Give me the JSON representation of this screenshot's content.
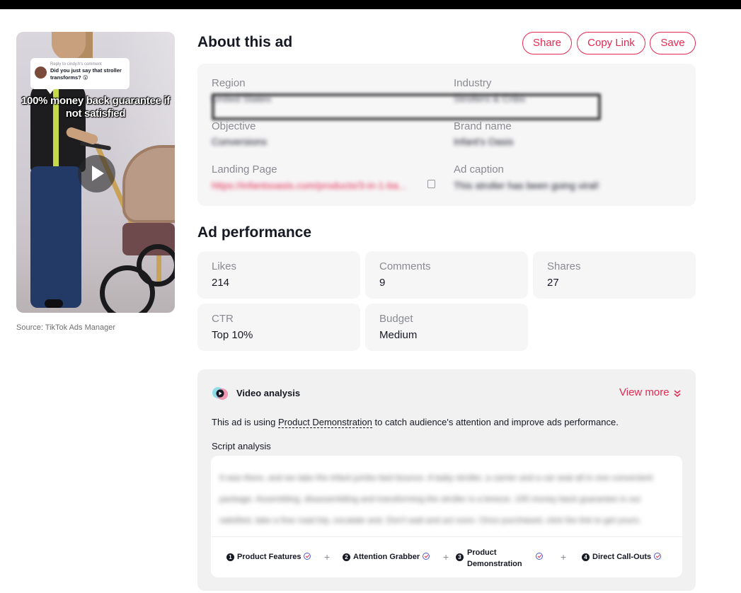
{
  "video": {
    "comment_reply": "Reply to cindy.h's comment",
    "comment_text": "Did you just say that stroller transforms? 😮",
    "overlay_caption": "100% money back guarantee if not satisfied",
    "source": "Source: TikTok Ads Manager"
  },
  "header": {
    "title": "About this ad",
    "share_label": "Share",
    "copy_label": "Copy Link",
    "save_label": "Save"
  },
  "details": {
    "region_label": "Region",
    "region_value": "United States",
    "industry_label": "Industry",
    "industry_value": "Strollers & Cribs",
    "objective_label": "Objective",
    "objective_value": "Conversions",
    "brand_label": "Brand name",
    "brand_value": "Infant's Oasis",
    "landing_label": "Landing Page",
    "landing_value": "https://infantsoasis.com/products/3-in-1-ba...",
    "caption_label": "Ad caption",
    "caption_value": "This stroller has been going viral!"
  },
  "performance": {
    "title": "Ad performance",
    "metrics": [
      {
        "label": "Likes",
        "value": "214"
      },
      {
        "label": "Comments",
        "value": "9"
      },
      {
        "label": "Shares",
        "value": "27"
      },
      {
        "label": "CTR",
        "value": "Top 10%"
      },
      {
        "label": "Budget",
        "value": "Medium"
      }
    ]
  },
  "analysis": {
    "title": "Video analysis",
    "view_more": "View more",
    "sentence_prefix": "This ad is using ",
    "sentence_highlight": "Product Demonstration",
    "sentence_suffix": " to catch audience's attention and improve ads performance.",
    "script_label": "Script analysis",
    "script_text": "It was there, and we take the infant jumbo bed bounce. A baby stroller, a carrier and a car seat all in one convenient package. Assembling, disassembling and transforming the stroller is a breeze. 100 money back guarantee is our satisfied, take a free road trip, escalate and. Don't wait and act soon. Once purchased, click the link to get yours.",
    "tags": [
      {
        "num": "1",
        "label": "Product Features"
      },
      {
        "num": "2",
        "label": "Attention Grabber"
      },
      {
        "num": "3",
        "label": "Product Demonstration"
      },
      {
        "num": "4",
        "label": "Direct Call-Outs"
      }
    ],
    "plus_symbol": "+"
  },
  "icons": {
    "play": "play-icon",
    "copy": "copy-icon",
    "analysis": "video-analysis-icon",
    "chevron": "double-chevron-down-icon",
    "check": "verified-check-icon"
  },
  "colors": {
    "accent": "#e5284f",
    "card_bg": "#f6f6f7",
    "label": "#8a8b91"
  }
}
